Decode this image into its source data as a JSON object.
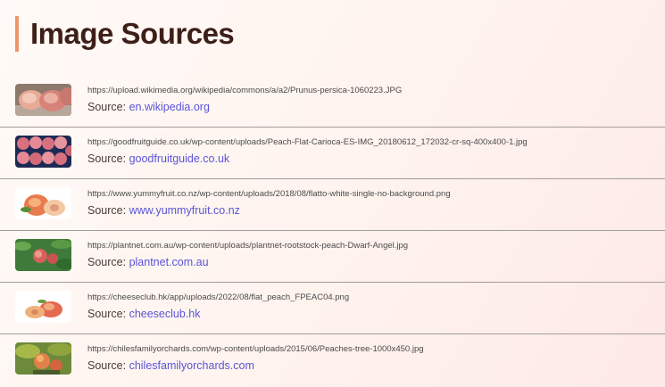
{
  "page": {
    "title": "Image Sources"
  },
  "colors": {
    "accent_bar": "#f0956a",
    "title": "#3d1f18",
    "link": "#5a54d6",
    "divider": "#a39c9a"
  },
  "sources": [
    {
      "thumb_icon": "peach-photo-icon",
      "url": "https://upload.wikimedia.org/wikipedia/commons/a/a2/Prunus-persica-1060223.JPG",
      "source_label": "Source:",
      "source_link": "en.wikipedia.org"
    },
    {
      "thumb_icon": "peach-photo-icon",
      "url": "https://goodfruitguide.co.uk/wp-content/uploads/Peach-Flat-Carioca-ES-IMG_20180612_172032-cr-sq-400x400-1.jpg",
      "source_label": "Source:",
      "source_link": "goodfruitguide.co.uk"
    },
    {
      "thumb_icon": "peach-photo-icon",
      "url": "https://www.yummyfruit.co.nz/wp-content/uploads/2018/08/flatto-white-single-no-background.png",
      "source_label": "Source:",
      "source_link": "www.yummyfruit.co.nz"
    },
    {
      "thumb_icon": "peach-tree-photo-icon",
      "url": "https://plantnet.com.au/wp-content/uploads/plantnet-rootstock-peach-Dwarf-Angel.jpg",
      "source_label": "Source:",
      "source_link": "plantnet.com.au"
    },
    {
      "thumb_icon": "peach-photo-icon",
      "url": "https://cheeseclub.hk/app/uploads/2022/08/flat_peach_FPEAC04.png",
      "source_label": "Source:",
      "source_link": "cheeseclub.hk"
    },
    {
      "thumb_icon": "peach-tree-photo-icon",
      "url": "https://chilesfamilyorchards.com/wp-content/uploads/2015/06/Peaches-tree-1000x450.jpg",
      "source_label": "Source:",
      "source_link": "chilesfamilyorchards.com"
    }
  ]
}
